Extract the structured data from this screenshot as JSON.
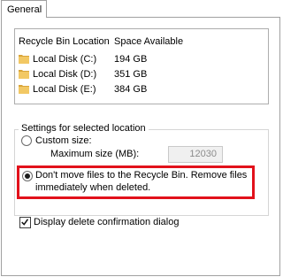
{
  "tab": {
    "label": "General"
  },
  "list": {
    "headers": {
      "location": "Recycle Bin Location",
      "space": "Space Available"
    },
    "rows": [
      {
        "name": "Local Disk (C:)",
        "space": "194 GB"
      },
      {
        "name": "Local Disk (D:)",
        "space": "351 GB"
      },
      {
        "name": "Local Disk (E:)",
        "space": "384 GB"
      }
    ]
  },
  "settings": {
    "group_title": "Settings for selected location",
    "custom_size_label": "Custom size:",
    "max_size_label": "Maximum size (MB):",
    "max_size_value": "12030",
    "dont_move_line1": "Don't move files to the Recycle Bin. Remove files",
    "dont_move_line2": "immediately when deleted.",
    "selected_option": "dont_move"
  },
  "confirm_dialog": {
    "label": "Display delete confirmation dialog",
    "checked": true
  },
  "colors": {
    "highlight": "#e2111b",
    "folder": "#e8b84a"
  }
}
